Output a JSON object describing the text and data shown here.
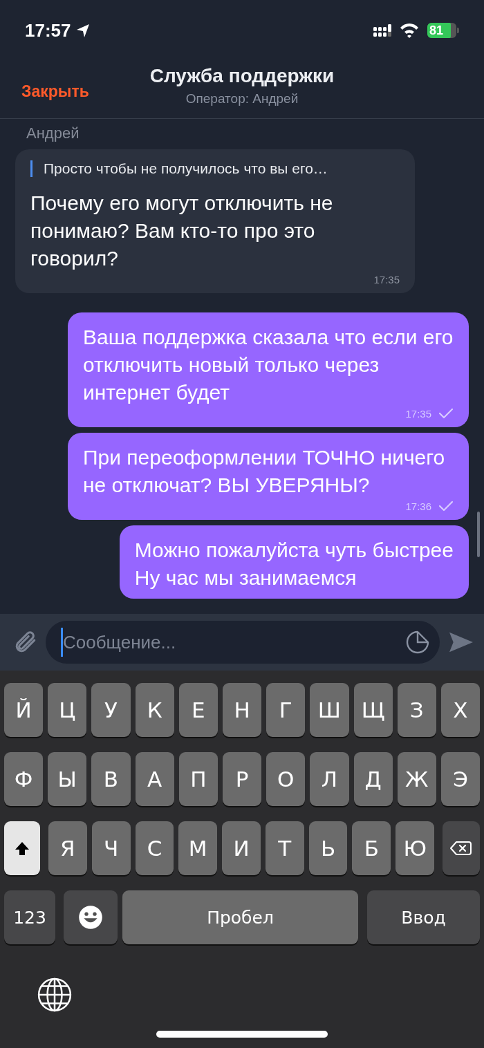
{
  "status_bar": {
    "time": "17:57",
    "battery": "81"
  },
  "header": {
    "close": "Закрыть",
    "title": "Служба поддержки",
    "subtitle": "Оператор: Андрей"
  },
  "messages": [
    {
      "kind": "incoming",
      "sender": "Андрей",
      "quote": "Просто чтобы не получилось что вы его…",
      "text": "Почему его могут отключить не понимаю? Вам кто-то про это говорил?",
      "time": "17:35"
    },
    {
      "kind": "outgoing",
      "text": "Ваша поддержка сказала что если его отключить новый только через интернет будет",
      "time": "17:35",
      "read": true
    },
    {
      "kind": "outgoing",
      "text": "При переоформлении ТОЧНО ничего не отключат? ВЫ УВЕРЯНЫ?",
      "time": "17:36",
      "read": true
    },
    {
      "kind": "outgoing",
      "text": "Можно пожалуйста чуть быстрее\nНу час мы занимаемся"
    }
  ],
  "composer": {
    "placeholder": "Сообщение..."
  },
  "keyboard": {
    "rows": [
      [
        {
          "kind": "letter",
          "label": "Й"
        },
        {
          "kind": "letter",
          "label": "Ц"
        },
        {
          "kind": "letter",
          "label": "У"
        },
        {
          "kind": "letter",
          "label": "К"
        },
        {
          "kind": "letter",
          "label": "Е"
        },
        {
          "kind": "letter",
          "label": "Н"
        },
        {
          "kind": "letter",
          "label": "Г"
        },
        {
          "kind": "letter",
          "label": "Ш"
        },
        {
          "kind": "letter",
          "label": "Щ"
        },
        {
          "kind": "letter",
          "label": "З"
        },
        {
          "kind": "letter",
          "label": "Х"
        }
      ],
      [
        {
          "kind": "letter",
          "label": "Ф"
        },
        {
          "kind": "letter",
          "label": "Ы"
        },
        {
          "kind": "letter",
          "label": "В"
        },
        {
          "kind": "letter",
          "label": "А"
        },
        {
          "kind": "letter",
          "label": "П"
        },
        {
          "kind": "letter",
          "label": "Р"
        },
        {
          "kind": "letter",
          "label": "О"
        },
        {
          "kind": "letter",
          "label": "Л"
        },
        {
          "kind": "letter",
          "label": "Д"
        },
        {
          "kind": "letter",
          "label": "Ж"
        },
        {
          "kind": "letter",
          "label": "Э"
        }
      ],
      [
        {
          "kind": "shift",
          "on": true
        },
        {
          "kind": "letter",
          "label": "Я"
        },
        {
          "kind": "letter",
          "label": "Ч"
        },
        {
          "kind": "letter",
          "label": "С"
        },
        {
          "kind": "letter",
          "label": "М"
        },
        {
          "kind": "letter",
          "label": "И"
        },
        {
          "kind": "letter",
          "label": "Т"
        },
        {
          "kind": "letter",
          "label": "Ь"
        },
        {
          "kind": "letter",
          "label": "Б"
        },
        {
          "kind": "letter",
          "label": "Ю"
        },
        {
          "kind": "backspace"
        }
      ]
    ],
    "bottom_keys": [
      {
        "kind": "numbers",
        "label": "123"
      },
      {
        "kind": "emoji"
      },
      {
        "kind": "space",
        "label": "Пробел"
      },
      {
        "kind": "return",
        "label": "Ввод"
      }
    ]
  }
}
